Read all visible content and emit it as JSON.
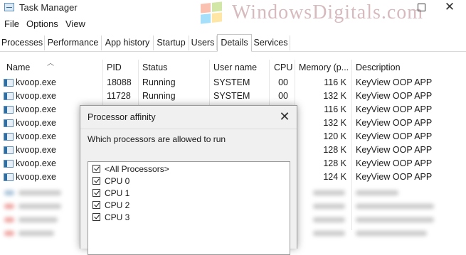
{
  "window": {
    "title": "Task Manager",
    "watermark": "WindowsDigitals.com"
  },
  "colors": {
    "logo_red": "#f25022",
    "logo_green": "#7fba00",
    "logo_blue": "#00a4ef",
    "logo_yellow": "#ffb900",
    "watermark": "#c9a3a9"
  },
  "menu": [
    "File",
    "Options",
    "View"
  ],
  "tabs": [
    "Processes",
    "Performance",
    "App history",
    "Startup",
    "Users",
    "Details",
    "Services"
  ],
  "active_tab": "Details",
  "columns": [
    "Name",
    "PID",
    "Status",
    "User name",
    "CPU",
    "Memory (p...",
    "Description"
  ],
  "rows": [
    {
      "name": "kvoop.exe",
      "pid": "18088",
      "status": "Running",
      "user": "SYSTEM",
      "cpu": "00",
      "mem": "116 K",
      "desc": "KeyView OOP APP"
    },
    {
      "name": "kvoop.exe",
      "pid": "11728",
      "status": "Running",
      "user": "SYSTEM",
      "cpu": "00",
      "mem": "132 K",
      "desc": "KeyView OOP APP"
    },
    {
      "name": "kvoop.exe",
      "pid": "",
      "status": "",
      "user": "",
      "cpu": "00",
      "mem": "116 K",
      "desc": "KeyView OOP APP"
    },
    {
      "name": "kvoop.exe",
      "pid": "",
      "status": "",
      "user": "",
      "cpu": "00",
      "mem": "132 K",
      "desc": "KeyView OOP APP"
    },
    {
      "name": "kvoop.exe",
      "pid": "",
      "status": "",
      "user": "",
      "cpu": "00",
      "mem": "120 K",
      "desc": "KeyView OOP APP"
    },
    {
      "name": "kvoop.exe",
      "pid": "",
      "status": "",
      "user": "",
      "cpu": "00",
      "mem": "128 K",
      "desc": "KeyView OOP APP"
    },
    {
      "name": "kvoop.exe",
      "pid": "",
      "status": "",
      "user": "",
      "cpu": "00",
      "mem": "128 K",
      "desc": "KeyView OOP APP"
    },
    {
      "name": "kvoop.exe",
      "pid": "",
      "status": "",
      "user": "",
      "cpu": "00",
      "mem": "124 K",
      "desc": "KeyView OOP APP"
    }
  ],
  "dialog": {
    "title": "Processor affinity",
    "close": "✕",
    "prompt": "Which processors are allowed to run",
    "processors": [
      {
        "label": "<All Processors>",
        "checked": true
      },
      {
        "label": "CPU 0",
        "checked": true
      },
      {
        "label": "CPU 1",
        "checked": true
      },
      {
        "label": "CPU 2",
        "checked": true
      },
      {
        "label": "CPU 3",
        "checked": true
      }
    ]
  }
}
